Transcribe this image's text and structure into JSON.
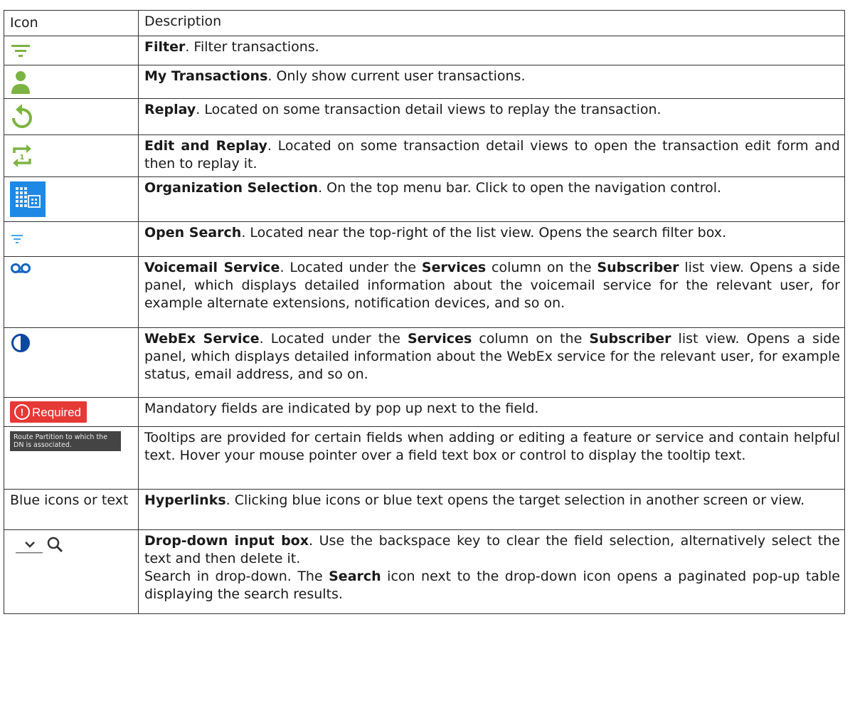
{
  "header": {
    "icon": "Icon",
    "description": "Description"
  },
  "colors": {
    "green": "#7cb342",
    "blue": "#1565c0",
    "light_blue": "#42a5f5",
    "dark_blue": "#0d47a1",
    "red": "#e53935"
  },
  "rows": [
    {
      "icon": "filter-icon",
      "bold": "Filter",
      "text": ". Filter transactions."
    },
    {
      "icon": "person-icon",
      "bold": "My Transactions",
      "text": ". Only show current user transactions."
    },
    {
      "icon": "replay-icon",
      "bold": "Replay",
      "text": ". Located on some transaction detail views to replay the transaction."
    },
    {
      "icon": "edit-replay-icon",
      "bold": "Edit and Replay",
      "text": ". Located on some transaction detail views to open the transaction edit form and then to replay it."
    },
    {
      "icon": "organization-icon",
      "bold": "Organization Selection",
      "text": ". On the top menu bar. Click to open the navigation control."
    },
    {
      "icon": "open-search-icon",
      "bold": "Open Search",
      "text": ". Located near the top-right of the list view. Opens the search filter box."
    },
    {
      "icon": "voicemail-icon",
      "bold": "Voicemail Service",
      "text1": ". Located under the ",
      "bold2": "Services",
      "text2": " column on the ",
      "bold3": "Subscriber",
      "text3": " list view. Opens a side panel, which displays detailed information about the voicemail service for the relevant user, for example alternate extensions, notification devices, and so on."
    },
    {
      "icon": "webex-icon",
      "bold": "WebEx Service",
      "text1": ". Located under the ",
      "bold2": "Services",
      "text2": " column on the ",
      "bold3": "Subscriber",
      "text3": " list view. Opens a side panel, which displays detailed information about the WebEx service for the relevant user, for example status, email address, and so on."
    },
    {
      "icon": "required-badge",
      "badge_text": "Required",
      "text": "Mandatory fields are indicated by pop up next to the field."
    },
    {
      "icon": "tooltip-sample",
      "tooltip_text": "Route Partition to which the DN is associated.",
      "text": "Tooltips are provided for certain fields when adding or editing a feature or service and contain helpful text. Hover your mouse pointer over a field text box or control to display the tooltip text."
    },
    {
      "icon_text": "Blue icons or text",
      "bold": "Hyperlinks",
      "text": ". Clicking blue icons or blue text opens the target selection in another screen or view."
    },
    {
      "icon": "dropdown-search-icon",
      "bold": "Drop-down input box",
      "text": ". Use the backspace key to clear the field selection, alternatively select the text and then delete it.",
      "text_b": "Search in drop-down. The ",
      "bold2": "Search",
      "text_c": " icon next to the drop-down icon opens a paginated pop-up table displaying the search results."
    }
  ]
}
